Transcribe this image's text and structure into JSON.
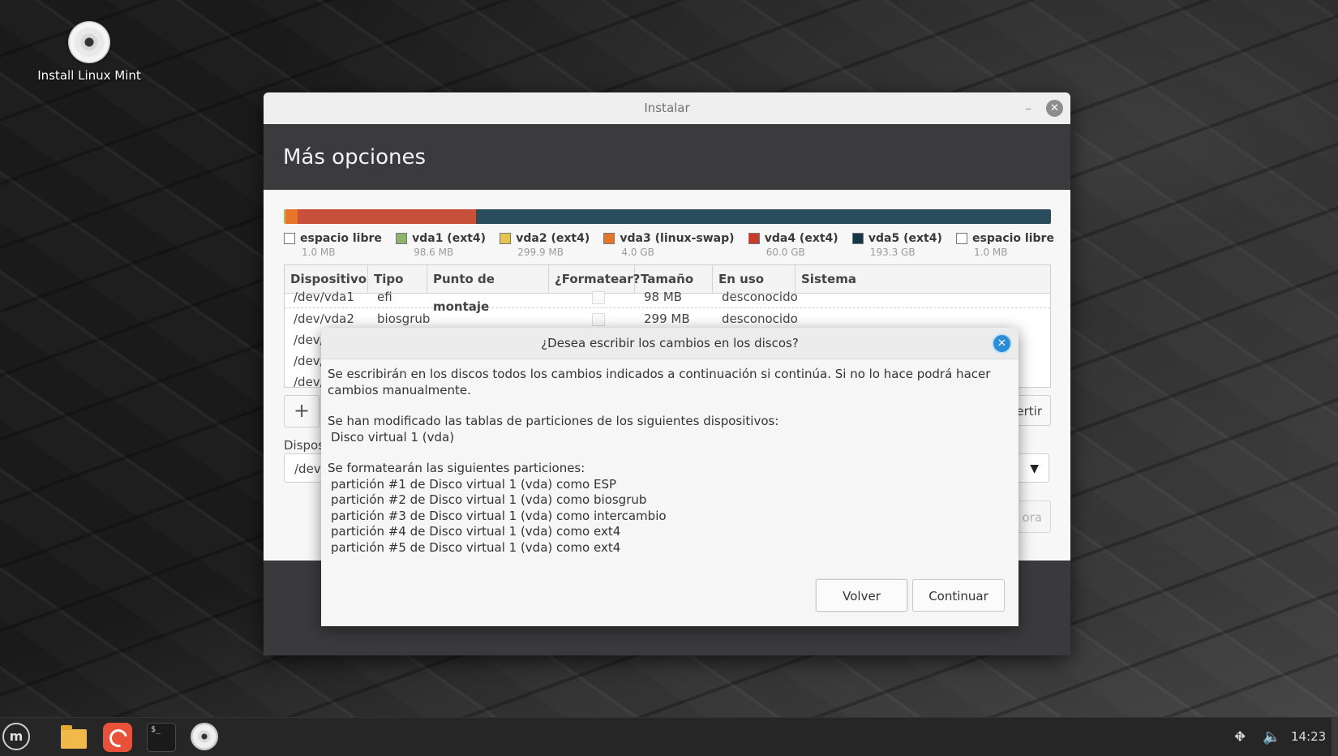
{
  "desktop": {
    "icon_label": "Install Linux Mint",
    "icon": "disc-icon"
  },
  "window": {
    "title": "Instalar",
    "minimize": "–",
    "close": "✕",
    "header": "Más opciones"
  },
  "partition_bar": {
    "segments": [
      {
        "name": "espacio libre",
        "color": "#f0f0f0",
        "fraction": 0.0004
      },
      {
        "name": "vda1 (ext4)",
        "color": "#8db46a",
        "fraction": 0.0004
      },
      {
        "name": "vda2 (ext4)",
        "color": "#e6c54a",
        "fraction": 0.0012
      },
      {
        "name": "vda3 (linux-swap)",
        "color": "#e8742c",
        "fraction": 0.016
      },
      {
        "name": "vda4 (ext4)",
        "color": "#c8503a",
        "fraction": 0.232
      },
      {
        "name": "vda5 (ext4)",
        "color": "#2a4d5e",
        "fraction": 0.75
      }
    ],
    "legend": [
      {
        "name": "espacio libre",
        "size": "1.0 MB",
        "color": "#ffffff"
      },
      {
        "name": "vda1 (ext4)",
        "size": "98.6 MB",
        "color": "#8db46a"
      },
      {
        "name": "vda2 (ext4)",
        "size": "299.9 MB",
        "color": "#e6c54a"
      },
      {
        "name": "vda3 (linux-swap)",
        "size": "4.0 GB",
        "color": "#e8742c"
      },
      {
        "name": "vda4 (ext4)",
        "size": "60.0 GB",
        "color": "#c83a2a"
      },
      {
        "name": "vda5 (ext4)",
        "size": "193.3 GB",
        "color": "#16374a"
      },
      {
        "name": "espacio libre",
        "size": "1.0 MB",
        "color": "#ffffff"
      }
    ]
  },
  "table": {
    "headers": [
      "Dispositivo",
      "Tipo",
      "Punto de montaje",
      "¿Formatear?",
      "Tamaño",
      "En uso",
      "Sistema"
    ],
    "rows": [
      {
        "device": "/dev/vda1",
        "type": "efi",
        "size": "98 MB",
        "in_use": "desconocido"
      },
      {
        "device": "/dev/vda2",
        "type": "biosgrub",
        "size": "299 MB",
        "in_use": "desconocido"
      },
      {
        "device": "/dev/"
      },
      {
        "device": "/dev/"
      },
      {
        "device": "/dev/"
      }
    ]
  },
  "controls": {
    "add": "+",
    "revert_partial": "ertir",
    "device_label_partial": "Dispos",
    "device_value_partial": "/dev/",
    "install_partial": "ora"
  },
  "dialog": {
    "title": "¿Desea escribir los cambios en los discos?",
    "intro": "Se escribirán en los discos todos los cambios indicados a continuación si continúa. Si no lo hace podrá hacer cambios manualmente.",
    "tables_heading": "Se han modificado las tablas de particiones de los siguientes dispositivos:",
    "devices": [
      "Disco virtual 1 (vda)"
    ],
    "format_heading": "Se formatearán las siguientes particiones:",
    "partitions": [
      "partición #1 de Disco virtual 1 (vda) como ESP",
      "partición #2 de Disco virtual 1 (vda) como biosgrub",
      "partición #3 de Disco virtual 1 (vda) como intercambio",
      "partición #4 de Disco virtual 1 (vda) como ext4",
      "partición #5 de Disco virtual 1 (vda) como ext4"
    ],
    "back_label": "Volver",
    "continue_label": "Continuar"
  },
  "taskbar": {
    "menu": "m",
    "terminal_prompt": "$_",
    "clock": "14:23",
    "icons": [
      "mint-menu-icon",
      "folder-icon",
      "firefox-icon",
      "terminal-icon",
      "disc-icon",
      "network-icon",
      "volume-icon"
    ]
  }
}
